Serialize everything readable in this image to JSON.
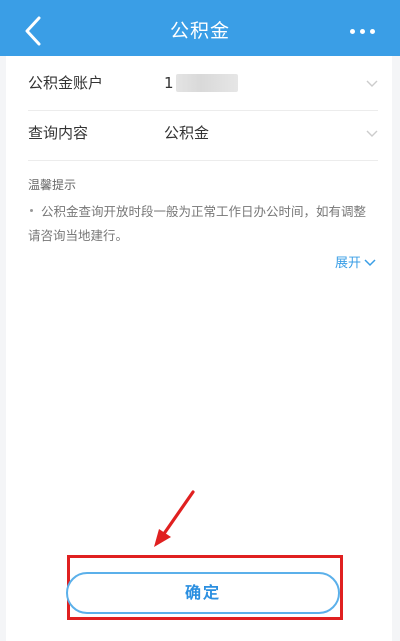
{
  "header": {
    "title": "公积金",
    "back_icon": "chevron-left-icon",
    "more_icon": "more-dots-icon"
  },
  "form": {
    "account": {
      "label": "公积金账户",
      "value": "1"
    },
    "query": {
      "label": "查询内容",
      "value": "公积金"
    }
  },
  "tips": {
    "title": "温馨提示",
    "text": "公积金查询开放时段一般为正常工作日办公时间，如有调整请咨询当地建行。",
    "expand_label": "展开"
  },
  "confirm": {
    "label": "确定"
  },
  "colors": {
    "header_bg": "#3a9ee6",
    "accent": "#2b8fe0",
    "annotation_red": "#e02020"
  }
}
